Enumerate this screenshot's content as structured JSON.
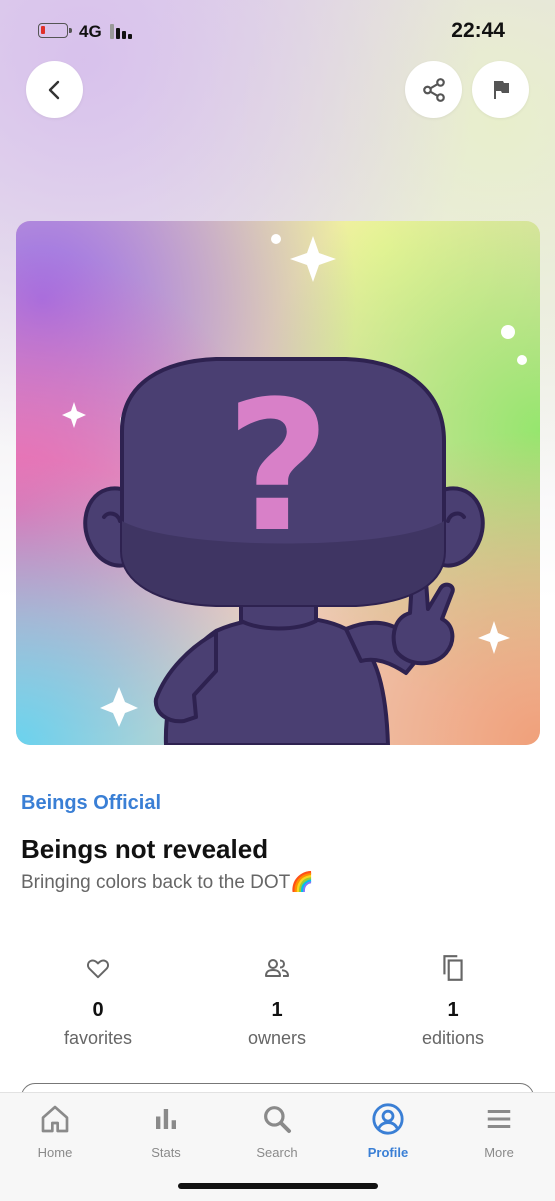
{
  "status_bar": {
    "network": "4G",
    "time": "22:44"
  },
  "header": {
    "back_icon": "chevron-left-icon",
    "share_icon": "share-icon",
    "flag_icon": "flag-icon"
  },
  "artwork": {
    "question_mark": "?",
    "colors": {
      "figure": "#4a3f72",
      "question": "#d880c8",
      "outline": "#2e2250"
    }
  },
  "nft": {
    "collection": "Beings Official",
    "title": "Beings not revealed",
    "description": "Bringing colors back to the DOT🌈"
  },
  "stats": [
    {
      "icon": "heart-icon",
      "value": "0",
      "label": "favorites"
    },
    {
      "icon": "people-icon",
      "value": "1",
      "label": "owners"
    },
    {
      "icon": "copy-icon",
      "value": "1",
      "label": "editions"
    }
  ],
  "tabbar": {
    "items": [
      {
        "icon": "home-icon",
        "label": "Home"
      },
      {
        "icon": "bar-chart-icon",
        "label": "Stats"
      },
      {
        "icon": "search-icon",
        "label": "Search"
      },
      {
        "icon": "profile-icon",
        "label": "Profile"
      },
      {
        "icon": "menu-icon",
        "label": "More"
      }
    ],
    "active": "Profile"
  },
  "colors": {
    "accent": "#3a7fd5",
    "text": "#111111",
    "muted": "#666666",
    "icon_gray": "#8a8a8a"
  }
}
